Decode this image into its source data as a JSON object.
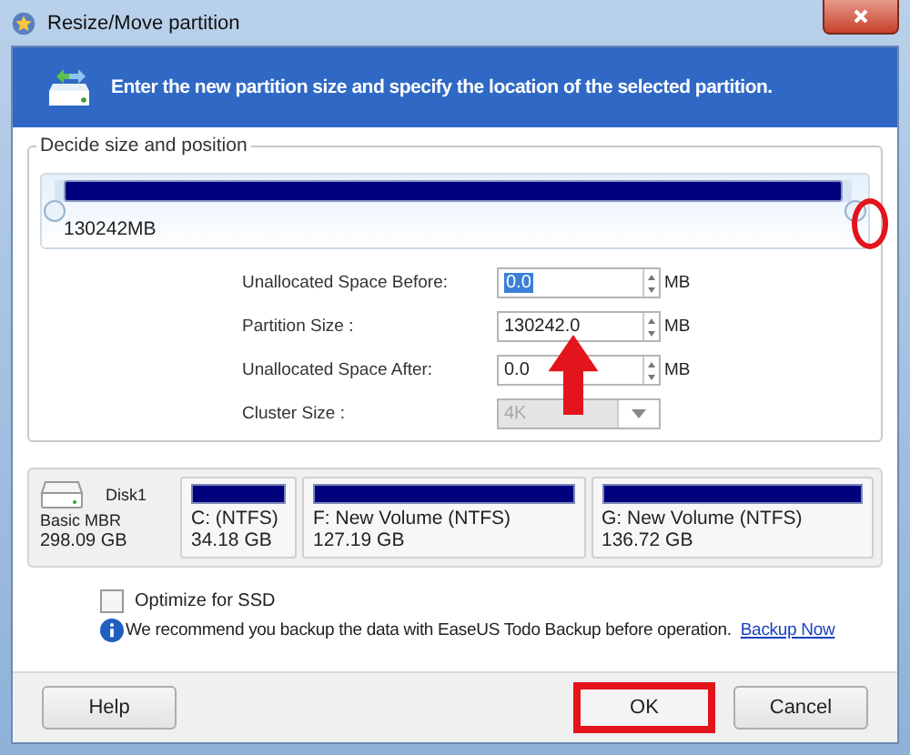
{
  "window": {
    "title": "Resize/Move partition"
  },
  "header": {
    "text": "Enter the new partition size and specify the location of the selected partition."
  },
  "group": {
    "title": "Decide size and position",
    "level": 1,
    "size_label": "130242MB"
  },
  "fields": [
    {
      "label": "Unallocated Space Before:",
      "value": "0.0",
      "unit": "MB",
      "kind": "spin",
      "selected": true
    },
    {
      "label": "Partition Size :",
      "value": "130242.0",
      "unit": "MB",
      "kind": "spin",
      "selected": false
    },
    {
      "label": "Unallocated Space After:",
      "value": "0.0",
      "unit": "MB",
      "kind": "spin",
      "selected": false
    },
    {
      "label": "Cluster Size :",
      "value": "4K",
      "kind": "combo",
      "disabled": true
    }
  ],
  "disk": {
    "name": "Disk1",
    "type": "Basic MBR",
    "size": "298.09 GB",
    "partitions": [
      {
        "name": "C: (NTFS)",
        "size": "34.18 GB"
      },
      {
        "name": "F: New Volume (NTFS)",
        "size": "127.19 GB"
      },
      {
        "name": "G: New Volume (NTFS)",
        "size": "136.72 GB"
      }
    ]
  },
  "optimize": {
    "label": "Optimize for SSD",
    "checked": false
  },
  "notice": {
    "text": "We recommend you backup the data with EaseUS Todo Backup before operation.",
    "link": "Backup Now"
  },
  "buttons": [
    {
      "label": "Help",
      "kind": "help"
    },
    {
      "label": "OK",
      "kind": "ok"
    },
    {
      "label": "Cancel",
      "kind": "cancel"
    }
  ]
}
